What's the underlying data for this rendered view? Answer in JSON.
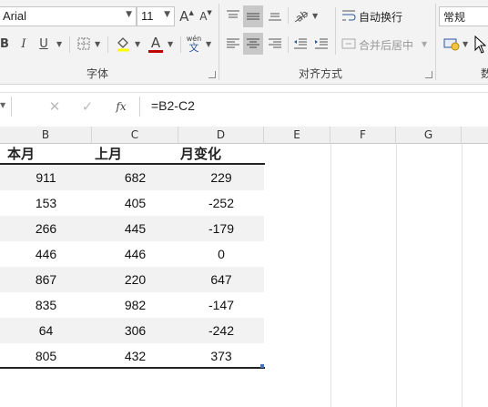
{
  "ribbon": {
    "font_name": "Arial",
    "font_size": "11",
    "font_group_label": "字体",
    "align_group_label": "对齐方式",
    "number_group_label_partial": "数",
    "wrap_text_label": "自动换行",
    "merge_center_label": "合并后居中",
    "number_format": "常规",
    "phonetic_top": "wén",
    "phonetic_bottom": "文",
    "bold": "B",
    "italic": "I",
    "underline": "U",
    "font_color_letter": "A",
    "grow_font": "A",
    "shrink_font": "A",
    "accent_red": "#c00000"
  },
  "formula_bar": {
    "formula": "=B2-C2",
    "fx": "fx"
  },
  "columns": [
    "B",
    "C",
    "D",
    "E",
    "F",
    "G"
  ],
  "headers": [
    "本月",
    "上月",
    "月变化"
  ],
  "rows": [
    [
      "911",
      "682",
      "229"
    ],
    [
      "153",
      "405",
      "-252"
    ],
    [
      "266",
      "445",
      "-179"
    ],
    [
      "446",
      "446",
      "0"
    ],
    [
      "867",
      "220",
      "647"
    ],
    [
      "835",
      "982",
      "-147"
    ],
    [
      "64",
      "306",
      "-242"
    ],
    [
      "805",
      "432",
      "373"
    ]
  ]
}
